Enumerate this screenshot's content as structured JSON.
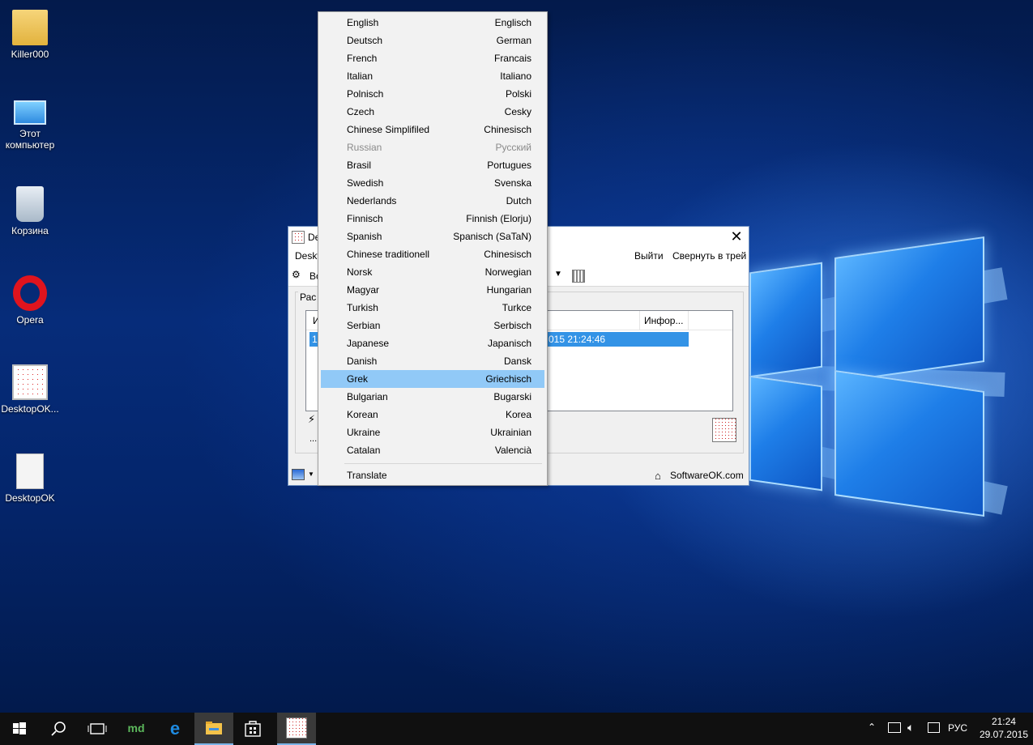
{
  "colors": {
    "menu_highlight": "#91c9f7",
    "selection_blue": "#3393e6",
    "taskbar_bg": "#101010",
    "disabled_text": "#8a8a8a"
  },
  "desktop_icons": [
    {
      "label": "Killer000",
      "icon": "user-folder-icon"
    },
    {
      "label": "Этот компьютер",
      "icon": "computer-icon"
    },
    {
      "label": "Корзина",
      "icon": "recycle-bin-icon"
    },
    {
      "label": "Opera",
      "icon": "opera-icon"
    },
    {
      "label": "DesktopOK...",
      "icon": "desktopok-icon"
    },
    {
      "label": "DesktopOK",
      "icon": "settings-file-icon"
    }
  ],
  "app_window": {
    "title_fragment": "De",
    "menu_left_fragment": "Deskt",
    "menu_right": [
      "Выйти",
      "Свернуть в трей"
    ],
    "toolbar_fragment": "Во",
    "group_fragment": "Рас",
    "list_header_col1": "И",
    "list_header_info": "Инфор...",
    "row_id_fragment": "1",
    "row_date_fragment": "015 21:24:46",
    "ellipsis": "...",
    "footer_link": "SoftwareOK.com",
    "close_glyph": "✕"
  },
  "language_menu": {
    "items": [
      {
        "left": "English",
        "right": "Englisch"
      },
      {
        "left": "Deutsch",
        "right": "German"
      },
      {
        "left": "French",
        "right": "Francais"
      },
      {
        "left": "Italian",
        "right": "Italiano"
      },
      {
        "left": "Polnisch",
        "right": "Polski"
      },
      {
        "left": "Czech",
        "right": "Cesky"
      },
      {
        "left": "Chinese Simplifiled",
        "right": "Chinesisch"
      },
      {
        "left": "Russian",
        "right": "Русский",
        "disabled": true
      },
      {
        "left": "Brasil",
        "right": "Portugues"
      },
      {
        "left": "Swedish",
        "right": "Svenska"
      },
      {
        "left": "Nederlands",
        "right": "Dutch"
      },
      {
        "left": "Finnisch",
        "right": "Finnish (Elorju)"
      },
      {
        "left": "Spanish",
        "right": "Spanisch (SaTaN)"
      },
      {
        "left": "Chinese traditionell",
        "right": "Chinesisch"
      },
      {
        "left": "Norsk",
        "right": "Norwegian"
      },
      {
        "left": "Magyar",
        "right": "Hungarian"
      },
      {
        "left": "Turkish",
        "right": "Turkce"
      },
      {
        "left": "Serbian",
        "right": "Serbisch"
      },
      {
        "left": "Japanese",
        "right": "Japanisch"
      },
      {
        "left": "Danish",
        "right": "Dansk"
      },
      {
        "left": "Grek",
        "right": "Griechisch",
        "highlighted": true
      },
      {
        "left": "Bulgarian",
        "right": "Bugarski"
      },
      {
        "left": "Korean",
        "right": "Korea"
      },
      {
        "left": "Ukraine",
        "right": "Ukrainian"
      },
      {
        "left": "Catalan",
        "right": "Valencià"
      }
    ],
    "translate_label": "Translate"
  },
  "taskbar": {
    "buttons": [
      "start-icon",
      "search-icon",
      "task-view-icon",
      "md-app-icon",
      "edge-icon",
      "file-explorer-icon",
      "store-icon",
      "desktopok-taskbar-icon"
    ],
    "md_label": "md",
    "language": "РУС",
    "time": "21:24",
    "date": "29.07.2015"
  }
}
